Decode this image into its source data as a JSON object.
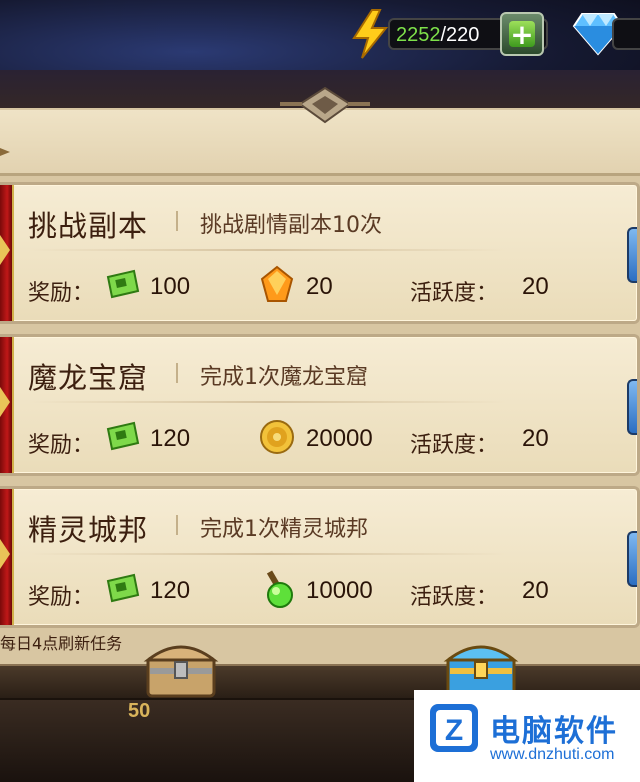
{
  "hud": {
    "energy_current": "2252",
    "energy_max": "/220",
    "plus_label": "+"
  },
  "tasks": [
    {
      "title": "挑战副本",
      "description": "挑战剧情副本10次",
      "reward_label": "奖励：",
      "reward1_icon": "green-ticket-icon",
      "reward1_value": "100",
      "reward2_icon": "orange-gem-icon",
      "reward2_value": "20",
      "activity_label": "活跃度：",
      "activity_value": "20"
    },
    {
      "title": "魔龙宝窟",
      "description": "完成1次魔龙宝窟",
      "reward_label": "奖励：",
      "reward1_icon": "green-ticket-icon",
      "reward1_value": "120",
      "reward2_icon": "gold-coin-icon",
      "reward2_value": "20000",
      "activity_label": "活跃度：",
      "activity_value": "20"
    },
    {
      "title": "精灵城邦",
      "description": "完成1次精灵城邦",
      "reward_label": "奖励：",
      "reward1_icon": "green-ticket-icon",
      "reward1_value": "120",
      "reward2_icon": "green-potion-icon",
      "reward2_value": "10000",
      "activity_label": "活跃度：",
      "activity_value": "20"
    }
  ],
  "footer": {
    "notice": "每日4点刷新任务",
    "chest1_value": "50"
  },
  "watermark": {
    "title": "电脑软件",
    "url": "www.dnzhuti.com"
  },
  "colors": {
    "energy_accent": "#7ee14a",
    "card_bg": "#f6ecd4",
    "card_tab": "#c01818",
    "text_dark": "#3c1f0f",
    "watermark_blue": "#1d6fd6"
  }
}
